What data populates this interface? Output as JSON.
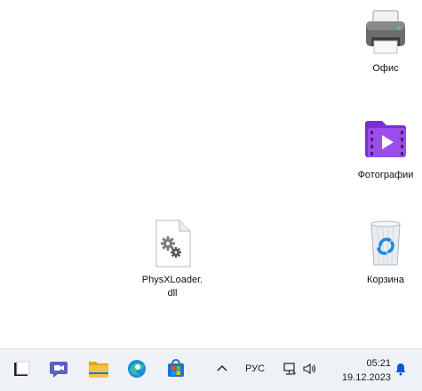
{
  "desktop": {
    "icons": [
      {
        "label": "Офис",
        "icon": "printer-icon"
      },
      {
        "label": "Фотографии",
        "icon": "photos-video-icon"
      },
      {
        "label": "PhysXLoader.\ndll",
        "icon": "dll-file-icon"
      },
      {
        "label": "Корзина",
        "icon": "recycle-bin-icon"
      }
    ]
  },
  "taskbar": {
    "apps": [
      "start-icon",
      "teams-chat-icon",
      "file-explorer-icon",
      "edge-icon",
      "store-icon"
    ],
    "tray": {
      "language": "РУС",
      "time": "05:21",
      "date": "19.12.2023"
    }
  },
  "colors": {
    "taskbar_bg": "#eef2f6",
    "photos_purple": "#7a2fd0",
    "folder_yellow": "#f5c342",
    "edge_blue": "#1b8ce0",
    "bell_blue": "#0b57d0"
  }
}
